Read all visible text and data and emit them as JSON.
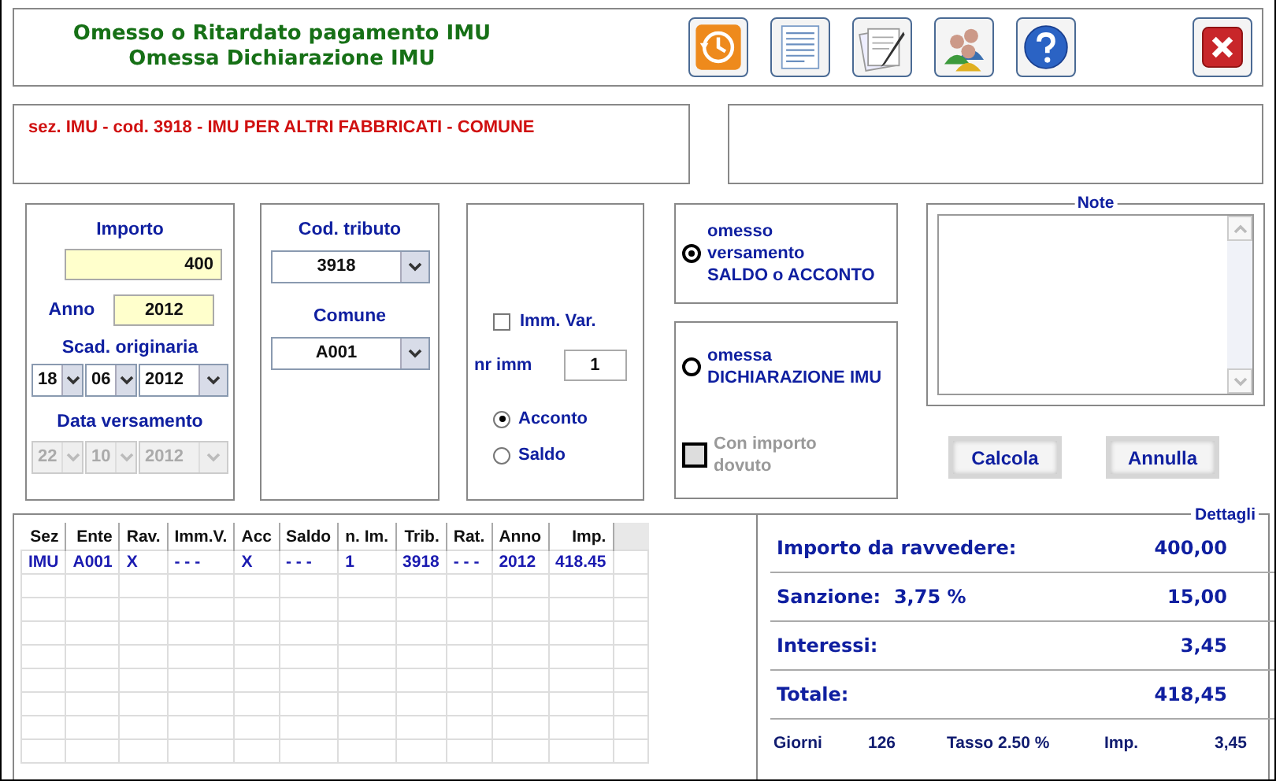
{
  "header": {
    "title_lines": [
      "Omesso o Ritardato pagamento IMU",
      "Omessa Dichiarazione IMU"
    ]
  },
  "info": {
    "text": "sez. IMU - cod. 3918 - IMU PER ALTRI FABBRICATI - COMUNE"
  },
  "importo": {
    "label": "Importo",
    "value": "400"
  },
  "anno": {
    "label": "Anno",
    "value": "2012"
  },
  "scadenza": {
    "label": "Scad. originaria",
    "parts": [
      "18",
      "06",
      "2012"
    ],
    "disabled": false
  },
  "versamento": {
    "label": "Data versamento",
    "parts": [
      "22",
      "10",
      "2012"
    ],
    "disabled": true
  },
  "cod_tributo": {
    "label": "Cod. tributo",
    "value": "3918"
  },
  "comune": {
    "label": "Comune",
    "value": "A001"
  },
  "imm_var": {
    "label": "Imm. Var.",
    "checked": false
  },
  "nr_imm": {
    "label": "nr imm",
    "value": "1"
  },
  "rata": [
    {
      "label": "Acconto",
      "selected": true
    },
    {
      "label": "Saldo",
      "selected": false
    }
  ],
  "tipo": [
    {
      "label_lines": [
        "omesso",
        "versamento",
        "SALDO o ACCONTO"
      ],
      "selected": true
    },
    {
      "label_lines": [
        "omessa",
        "DICHIARAZIONE IMU"
      ],
      "selected": false
    }
  ],
  "con_importo": {
    "label_lines": [
      "Con importo",
      "dovuto"
    ],
    "checked": false,
    "disabled": true
  },
  "note": {
    "title": "Note"
  },
  "buttons": [
    "Calcola",
    "Annulla"
  ],
  "table": {
    "columns": [
      "Sez",
      "Ente",
      "Rav.",
      "Imm.V.",
      "Acc",
      "Saldo",
      "n. Im.",
      "Trib.",
      "Rat.",
      "Anno",
      "Imp."
    ],
    "rows": [
      [
        "IMU",
        "A001",
        "X",
        "- - -",
        "X",
        "- - -",
        "1",
        "3918",
        "- - -",
        "2012",
        "418.45"
      ]
    ]
  },
  "details": {
    "title": "Dettagli",
    "rows": [
      {
        "label": "Importo da ravvedere:",
        "value": "400,00"
      },
      {
        "label": "Sanzione:  3,75 %",
        "value": "15,00"
      },
      {
        "label": "Interessi:",
        "value": "3,45"
      },
      {
        "label": "Totale:",
        "value": "418,45"
      }
    ],
    "footer": {
      "giorni_label": "Giorni",
      "giorni": "126",
      "tasso": "Tasso 2.50 %",
      "imp_label": "Imp.",
      "imp": "3,45"
    }
  }
}
